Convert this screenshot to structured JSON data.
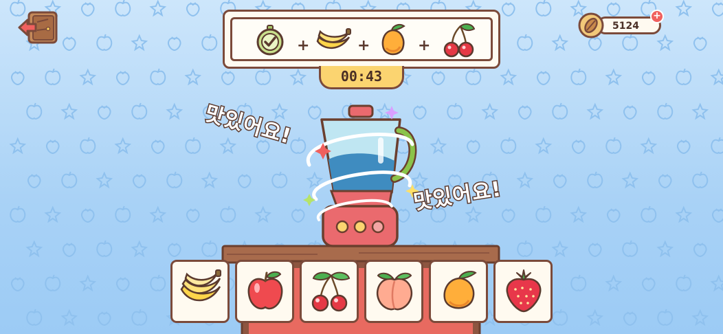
{
  "hud": {
    "coins": "5124",
    "coin_icon": "almond-coin-icon",
    "add_coins": "+",
    "exit_icon": "exit-door-icon"
  },
  "recipe": {
    "items": [
      "check-icon",
      "banana-icon",
      "mango-icon",
      "cherry-icon"
    ],
    "plus": "+",
    "timer": "00:43"
  },
  "speech": {
    "yummy_1": "맛있어요!",
    "yummy_2": "맛있어요!"
  },
  "fruit_tray": [
    {
      "fruit": "banana-icon"
    },
    {
      "fruit": "apple-icon"
    },
    {
      "fruit": "cherry-icon"
    },
    {
      "fruit": "peach-icon"
    },
    {
      "fruit": "mango-icon"
    },
    {
      "fruit": "strawberry-icon"
    }
  ],
  "colors": {
    "outline": "#7b4a3a",
    "panel": "#fffaf0",
    "timer": "#fbd470",
    "background": "#a9d2f6",
    "blender_base": "#ea6a6e"
  }
}
